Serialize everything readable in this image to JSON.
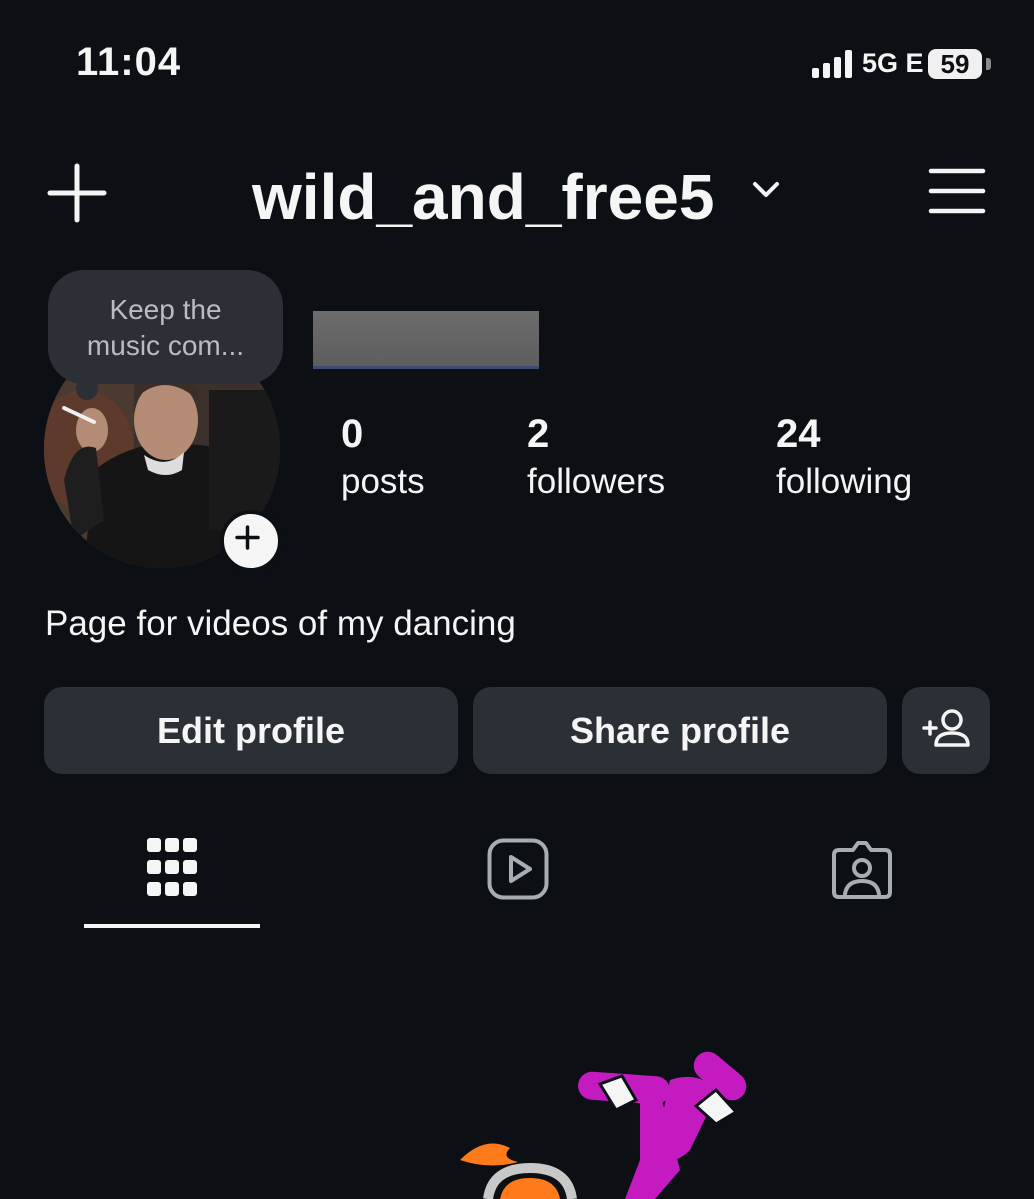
{
  "status_bar": {
    "time": "11:04",
    "network": "5G E",
    "battery": "59"
  },
  "header": {
    "username": "wild_and_free5",
    "icons": [
      "plus-icon",
      "chevron-down-icon",
      "hamburger-menu-icon"
    ]
  },
  "profile": {
    "note": "Keep the music com...",
    "stats": [
      {
        "value": "0",
        "label": "posts"
      },
      {
        "value": "2",
        "label": "followers"
      },
      {
        "value": "24",
        "label": "following"
      }
    ],
    "bio": "Page for videos of my dancing"
  },
  "actions": {
    "edit_label": "Edit profile",
    "share_label": "Share profile",
    "discover_icon": "add-person-icon"
  },
  "tabs": [
    {
      "icon": "grid-icon",
      "active": true
    },
    {
      "icon": "reels-icon",
      "active": false
    },
    {
      "icon": "tagged-icon",
      "active": false
    }
  ],
  "colors": {
    "background": "#0c1014",
    "button": "#2b2f36",
    "text": "#f5f5f5",
    "illustration_magenta": "#c41bc1",
    "illustration_orange": "#ff7a1a"
  }
}
